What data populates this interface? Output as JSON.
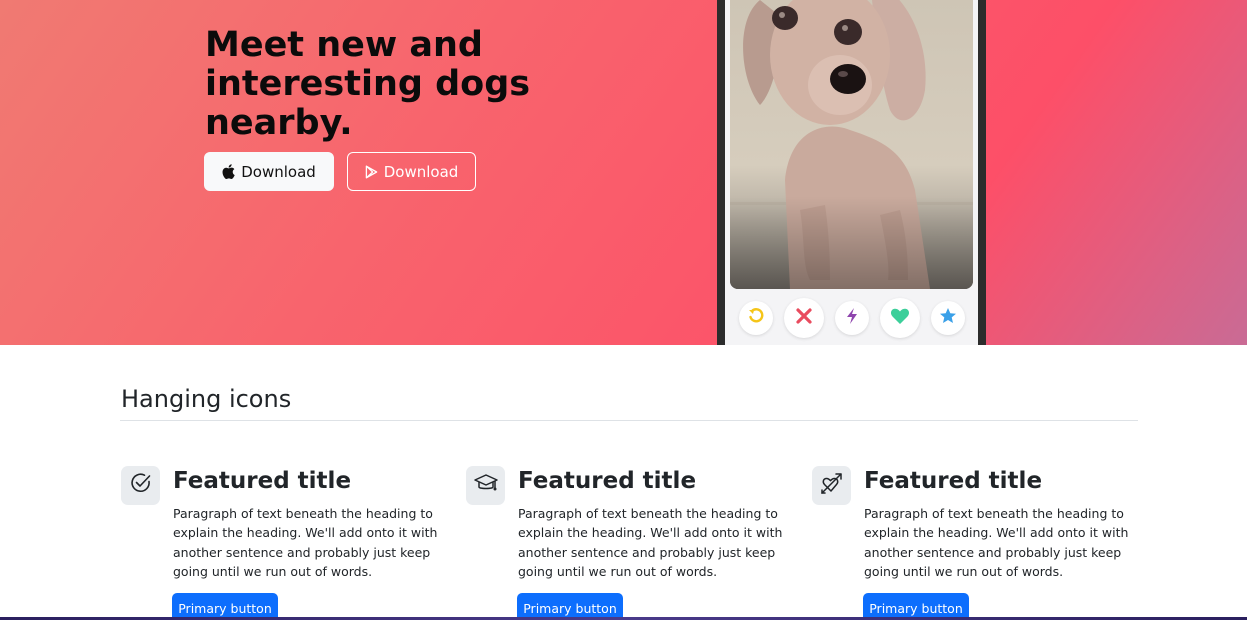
{
  "hero": {
    "title": "Meet new and interesting dogs nearby.",
    "apple_button_label": "Download",
    "play_button_label": "Download",
    "apple_icon": "apple-icon",
    "play_icon": "google-play-icon"
  },
  "phone": {
    "actions": [
      {
        "icon": "rewind-icon",
        "color": "#f5c518"
      },
      {
        "icon": "close-icon",
        "color": "#e94b5e"
      },
      {
        "icon": "bolt-icon",
        "color": "#8e44ad"
      },
      {
        "icon": "heart-icon",
        "color": "#3ccf9a"
      },
      {
        "icon": "star-icon",
        "color": "#3aa0e8"
      }
    ]
  },
  "section": {
    "title": "Hanging icons"
  },
  "features": [
    {
      "icon": "check-circle-icon",
      "title": "Featured title",
      "text": "Paragraph of text beneath the heading to explain the heading. We'll add onto it with another sentence and probably just keep going until we run out of words.",
      "button_label": "Primary button"
    },
    {
      "icon": "mortarboard-icon",
      "title": "Featured title",
      "text": "Paragraph of text beneath the heading to explain the heading. We'll add onto it with another sentence and probably just keep going until we run out of words.",
      "button_label": "Primary button"
    },
    {
      "icon": "arrow-through-heart-icon",
      "title": "Featured title",
      "text": "Paragraph of text beneath the heading to explain the heading. We'll add onto it with another sentence and probably just keep going until we run out of words.",
      "button_label": "Primary button"
    }
  ],
  "colors": {
    "primary": "#0d6efd",
    "hero_gradient_start": "#f07a72",
    "hero_gradient_end": "#fd4f68"
  }
}
